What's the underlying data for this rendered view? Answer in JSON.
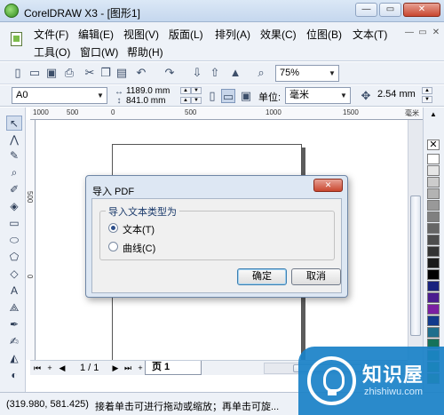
{
  "window": {
    "title": "CorelDRAW X3 - [图形1]",
    "min_glyph": "—",
    "max_glyph": "▭",
    "close_glyph": "✕"
  },
  "menu": {
    "row1": [
      "文件(F)",
      "编辑(E)",
      "视图(V)",
      "版面(L)",
      "排列(A)",
      "效果(C)",
      "位图(B)",
      "文本(T)"
    ],
    "row2": [
      "工具(O)",
      "窗口(W)",
      "帮助(H)"
    ],
    "doc_controls": [
      "—",
      "▭",
      "✕"
    ]
  },
  "toolbar1": {
    "icons": [
      "new-icon",
      "open-icon",
      "save-icon",
      "print-icon",
      "cut-icon",
      "copy-icon",
      "paste-icon",
      "undo-icon",
      "redo-icon",
      "import-icon",
      "export-icon",
      "launcher-icon",
      "zoom-icon"
    ],
    "zoom_value": "75%"
  },
  "toolbar2": {
    "paper_size": "A0",
    "width": "1189.0 mm",
    "height": "841.0 mm",
    "units_label": "单位:",
    "units_value": "毫米",
    "nudge_value": "2.54 mm"
  },
  "ruler": {
    "h_ticks": [
      "1000",
      "500",
      "0",
      "500",
      "1000",
      "1500"
    ],
    "h_unit": "毫米",
    "v_ticks": [
      "500",
      "0"
    ]
  },
  "pagenav": {
    "count": "1 / 1",
    "tab": "页 1"
  },
  "status": {
    "coords": "(319.980, 581.425)",
    "hint": "接着单击可进行拖动或缩放；再单击可旋..."
  },
  "dialog": {
    "title": "导入 PDF",
    "close_glyph": "✕",
    "group_label": "导入文本类型为",
    "options": [
      {
        "label": "文本(T)",
        "selected": true
      },
      {
        "label": "曲线(C)",
        "selected": false
      }
    ],
    "ok_label": "确定",
    "cancel_label": "取消"
  },
  "palette": {
    "colors": [
      "#ffffff",
      "#e6e6e6",
      "#cccccc",
      "#b3b3b3",
      "#999999",
      "#808080",
      "#666666",
      "#4d4d4d",
      "#333333",
      "#1a1a1a",
      "#000000",
      "#1a237e",
      "#4b1d8f",
      "#7b1fa2",
      "#123a8c",
      "#1f6e8c",
      "#15725a",
      "#1d8f4a",
      "#2e9e3b",
      "#56a82e"
    ]
  },
  "watermark": {
    "title": "知识屋",
    "subtitle": "zhishiwu.com"
  }
}
